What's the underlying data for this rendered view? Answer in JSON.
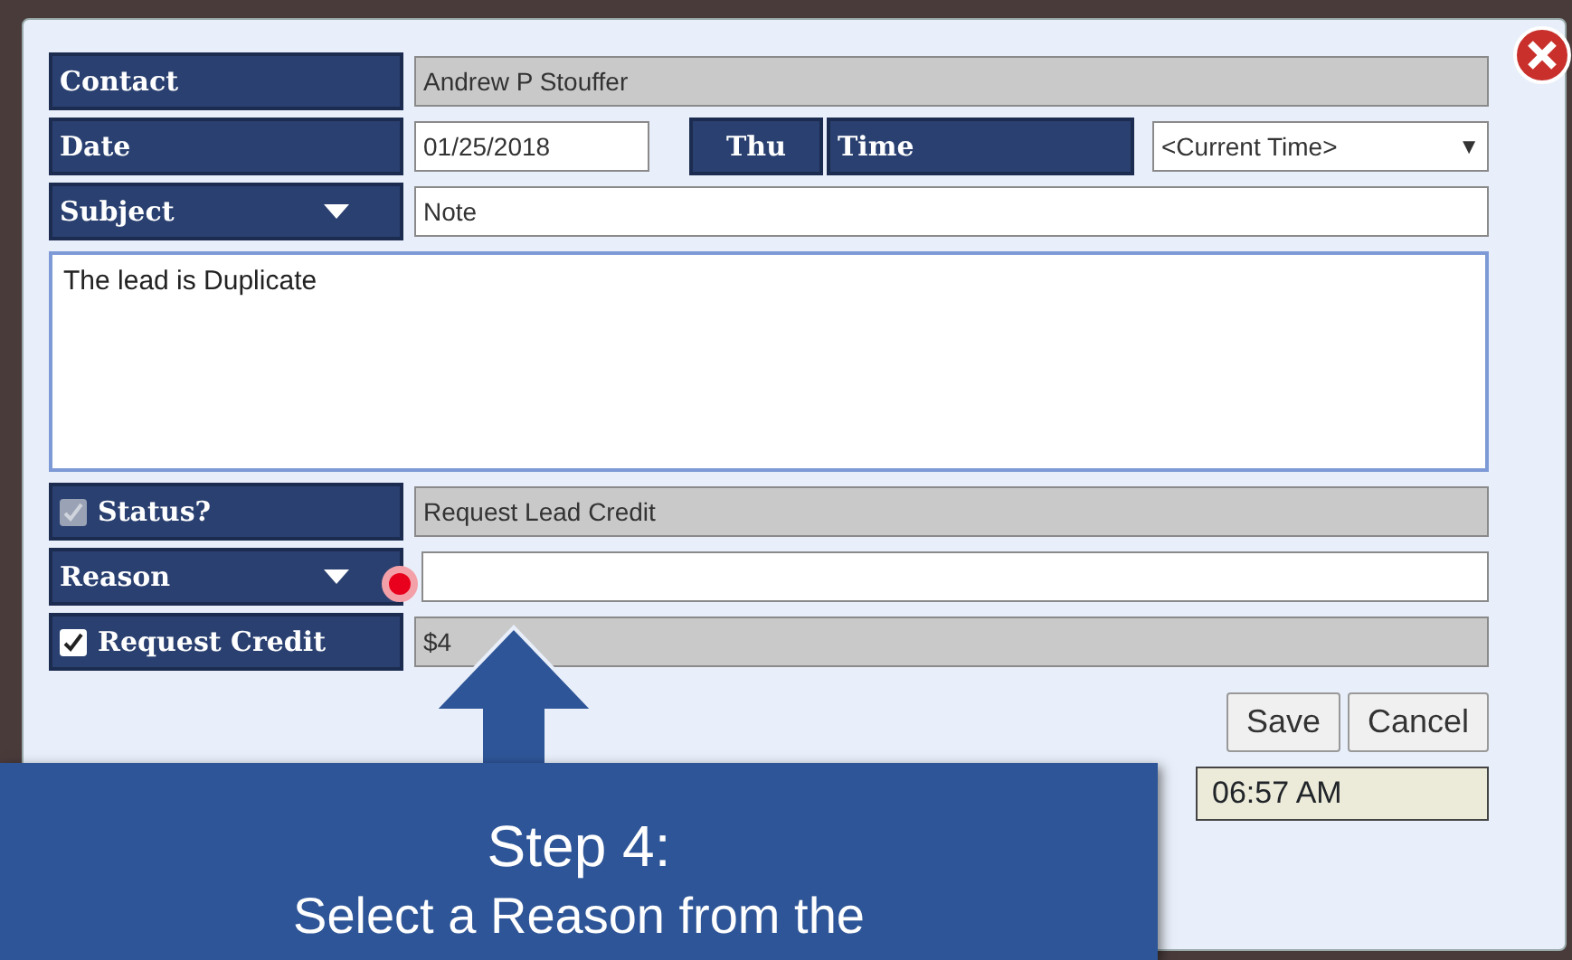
{
  "dialog": {
    "contact": {
      "label": "Contact",
      "value": "Andrew P Stouffer"
    },
    "date": {
      "label": "Date",
      "value": "01/25/2018",
      "day": "Thu",
      "time_label": "Time",
      "time_value": "<Current Time>",
      "time_caret": "▼"
    },
    "subject": {
      "label": "Subject",
      "value": "Note"
    },
    "note": {
      "value": "The lead is Duplicate"
    },
    "status": {
      "label": "Status?",
      "checked": true,
      "disabled": true,
      "value": "Request Lead Credit"
    },
    "reason": {
      "label": "Reason"
    },
    "request_credit": {
      "label": "Request Credit",
      "checked": true,
      "disabled": false,
      "value": "$4"
    },
    "buttons": [
      "Save",
      "Cancel"
    ],
    "timestamp": "06:57 AM"
  },
  "callout": {
    "title": "Step 4:",
    "text": "Select a Reason from the"
  }
}
